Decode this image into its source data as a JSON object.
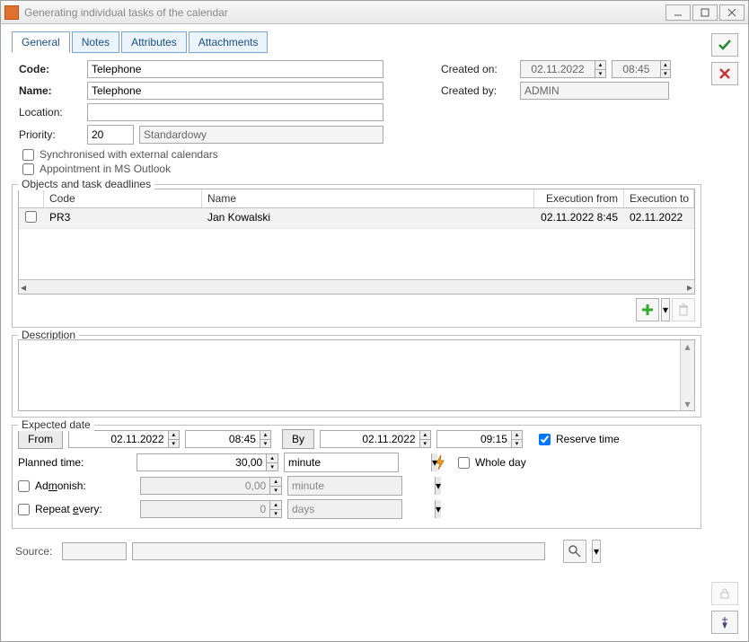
{
  "title": "Generating individual tasks of the calendar",
  "tabs": [
    "General",
    "Notes",
    "Attributes",
    "Attachments"
  ],
  "labels": {
    "code": "Code:",
    "name": "Name:",
    "location": "Location:",
    "priority": "Priority:",
    "created_on": "Created on:",
    "created_by": "Created by:",
    "sync": "Synchronised with external calendars",
    "outlook": "Appointment in MS Outlook",
    "objects_legend": "Objects and task deadlines",
    "description_legend": "Description",
    "expected_legend": "Expected date",
    "from": "From",
    "by": "By",
    "reserve_time": "Reserve time",
    "planned_time": "Planned time:",
    "admonish_pre": "Ad",
    "admonish_u": "m",
    "admonish_post": "onish:",
    "repeat_pre": "Repeat ",
    "repeat_u": "e",
    "repeat_post": "very:",
    "whole_day": "Whole day",
    "source": "Source:"
  },
  "values": {
    "code": "Telephone",
    "name": "Telephone",
    "location": "",
    "priority": "20",
    "priority_desc": "Standardowy",
    "created_on_date": "02.11.2022",
    "created_on_time": "08:45",
    "created_by": "ADMIN",
    "from_date": "02.11.2022",
    "from_time": "08:45",
    "by_date": "02.11.2022",
    "by_time": "09:15",
    "planned_time": "30,00",
    "planned_unit": "minute",
    "admonish_value": "0,00",
    "admonish_unit": "minute",
    "repeat_value": "0",
    "repeat_unit": "days",
    "source_code": "",
    "source_name": ""
  },
  "grid": {
    "headers": {
      "code": "Code",
      "name": "Name",
      "exec_from": "Execution from",
      "exec_to": "Execution to"
    },
    "rows": [
      {
        "code": "PR3",
        "name": "Jan Kowalski",
        "exec_from": "02.11.2022 8:45",
        "exec_to": "02.11.2022"
      }
    ]
  }
}
